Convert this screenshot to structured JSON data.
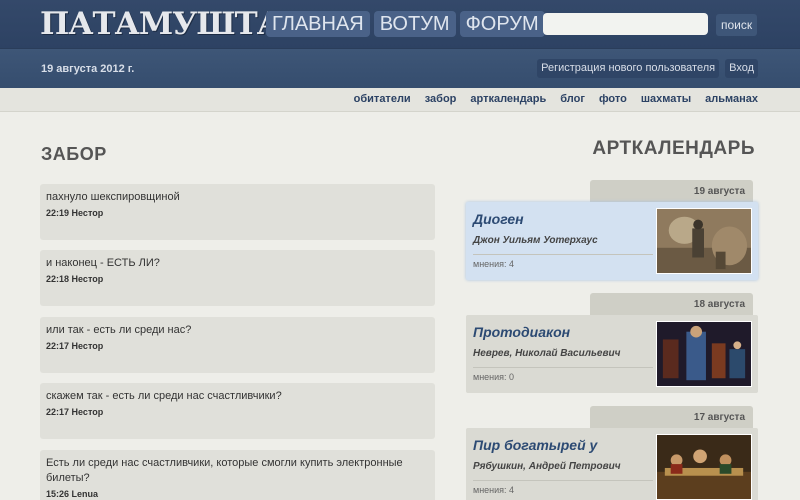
{
  "header": {
    "logo": "ПАТАМУШТА",
    "nav": [
      "ГЛАВНАЯ",
      "ВОТУМ",
      "ФОРУМ"
    ],
    "search_button": "поиск",
    "date": "19 августа 2012 г.",
    "register": "Регистрация нового пользователя",
    "login": "Вход"
  },
  "subnav": [
    "обитатели",
    "забор",
    "арткалендарь",
    "блог",
    "фото",
    "шахматы",
    "альманах"
  ],
  "left": {
    "title": "ЗАБОР",
    "posts": [
      {
        "text": "пахнуло шекспировщиной",
        "time": "22:19",
        "author": "Нестор"
      },
      {
        "text": "и наконец - ЕСТЬ ЛИ?",
        "time": "22:18",
        "author": "Нестор"
      },
      {
        "text": "или так - есть ли среди нас?",
        "time": "22:17",
        "author": "Нестор"
      },
      {
        "text": "скажем так - есть ли среди нас счастливчики?",
        "time": "22:17",
        "author": "Нестор"
      },
      {
        "text": "Есть ли среди нас счастливчики, которые смогли купить электронные билеты?",
        "time": "15:26",
        "author": "Lenua"
      }
    ]
  },
  "right": {
    "title": "АРТКАЛЕНДАРЬ",
    "events": [
      {
        "date": "19 августа",
        "title": "Диоген",
        "author": "Джон Уильям Уотерхаус",
        "opinions": "мнения: 4"
      },
      {
        "date": "18 августа",
        "title": "Протодиакон",
        "author": "Неврев, Николай Васильевич",
        "opinions": "мнения: 0"
      },
      {
        "date": "17 августа",
        "title": "Пир богатырей у",
        "author": "Рябушкин, Андрей Петрович",
        "opinions": "мнения: 4"
      }
    ]
  }
}
